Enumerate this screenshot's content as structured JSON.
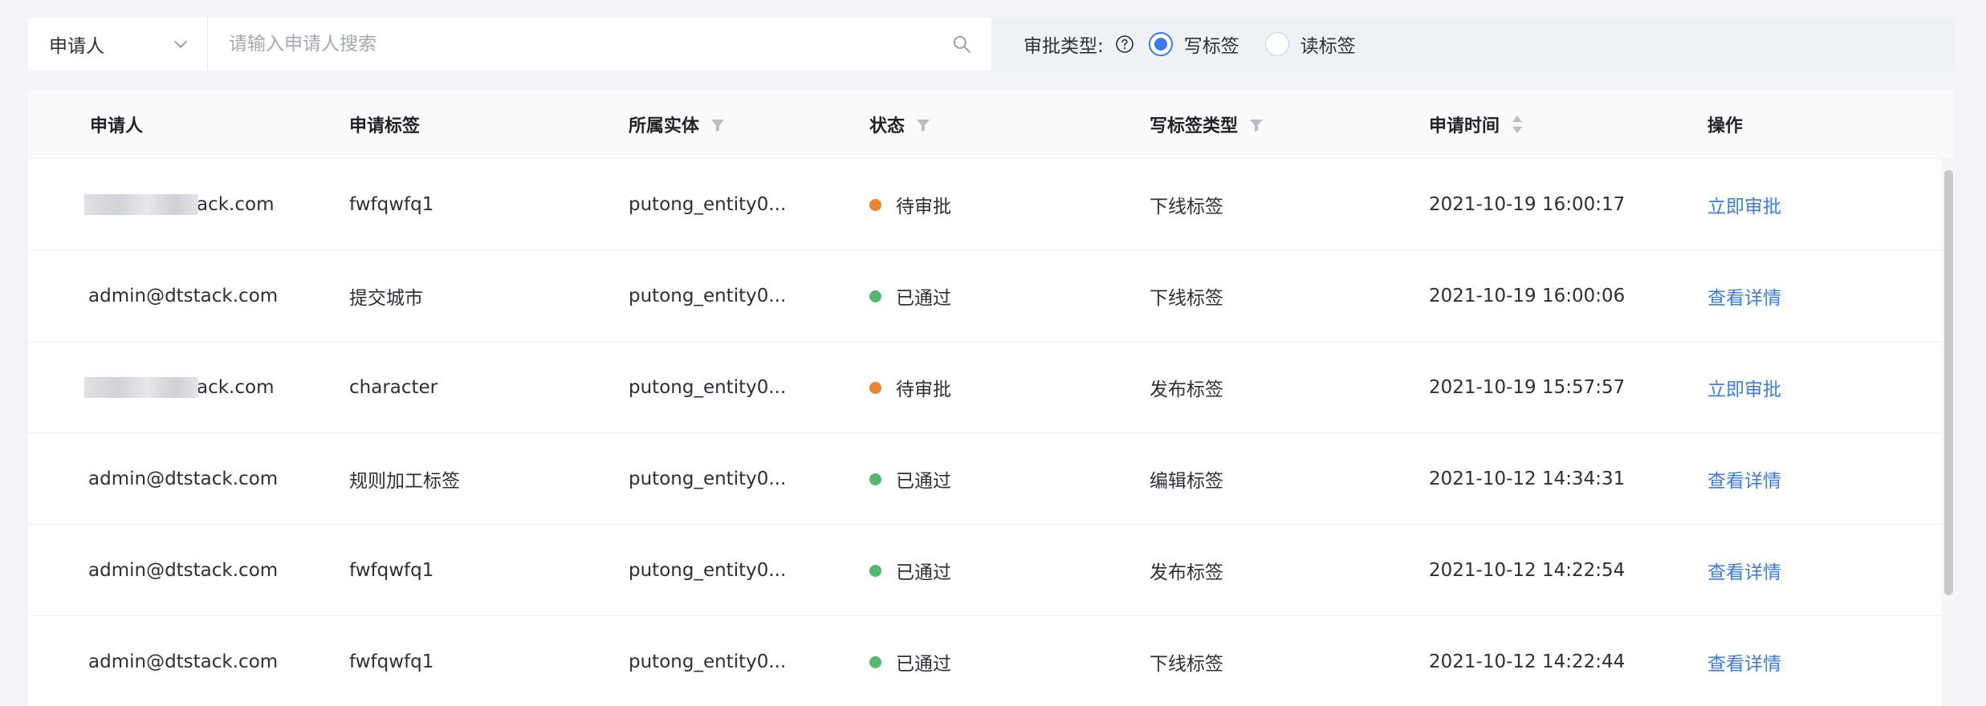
{
  "filter": {
    "select_label": "申请人",
    "search_placeholder": "请输入申请人搜索",
    "search_value": "",
    "approval_type_label": "审批类型:",
    "radios": [
      {
        "label": "写标签",
        "checked": true
      },
      {
        "label": "读标签",
        "checked": false
      }
    ]
  },
  "table": {
    "columns": [
      {
        "label": "申请人",
        "filter": false,
        "sort": false
      },
      {
        "label": "申请标签",
        "filter": false,
        "sort": false
      },
      {
        "label": "所属实体",
        "filter": true,
        "sort": false
      },
      {
        "label": "状态",
        "filter": true,
        "sort": false
      },
      {
        "label": "写标签类型",
        "filter": true,
        "sort": false
      },
      {
        "label": "申请时间",
        "filter": false,
        "sort": true
      },
      {
        "label": "操作",
        "filter": false,
        "sort": false
      }
    ],
    "rows": [
      {
        "applicant_visible": "ack.com",
        "applicant_blurred": true,
        "tag": "fwfqwfq1",
        "entity": "putong_entity0...",
        "status": "待审批",
        "status_color": "#e8852f",
        "write_type": "下线标签",
        "time": "2021-10-19 16:00:17",
        "action": "立即审批"
      },
      {
        "applicant_visible": "admin@dtstack.com",
        "applicant_blurred": false,
        "tag": "提交城市",
        "entity": "putong_entity0...",
        "status": "已通过",
        "status_color": "#52b96b",
        "write_type": "下线标签",
        "time": "2021-10-19 16:00:06",
        "action": "查看详情"
      },
      {
        "applicant_visible": "ack.com",
        "applicant_blurred": true,
        "tag": "character",
        "entity": "putong_entity0...",
        "status": "待审批",
        "status_color": "#e8852f",
        "write_type": "发布标签",
        "time": "2021-10-19 15:57:57",
        "action": "立即审批"
      },
      {
        "applicant_visible": "admin@dtstack.com",
        "applicant_blurred": false,
        "tag": "规则加工标签",
        "entity": "putong_entity0...",
        "status": "已通过",
        "status_color": "#52b96b",
        "write_type": "编辑标签",
        "time": "2021-10-12 14:34:31",
        "action": "查看详情"
      },
      {
        "applicant_visible": "admin@dtstack.com",
        "applicant_blurred": false,
        "tag": "fwfqwfq1",
        "entity": "putong_entity0...",
        "status": "已通过",
        "status_color": "#52b96b",
        "write_type": "发布标签",
        "time": "2021-10-12 14:22:54",
        "action": "查看详情"
      },
      {
        "applicant_visible": "admin@dtstack.com",
        "applicant_blurred": false,
        "tag": "fwfqwfq1",
        "entity": "putong_entity0...",
        "status": "已通过",
        "status_color": "#52b96b",
        "write_type": "下线标签",
        "time": "2021-10-12 14:22:44",
        "action": "查看详情"
      }
    ]
  },
  "colors": {
    "accent": "#3b7af5",
    "pending": "#e8852f",
    "approved": "#52b96b"
  },
  "icons": {
    "select": "chevron-down-icon",
    "search": "search-icon",
    "help": "question-circle-icon",
    "filter": "funnel-icon",
    "sort": "sort-caret-icon"
  }
}
